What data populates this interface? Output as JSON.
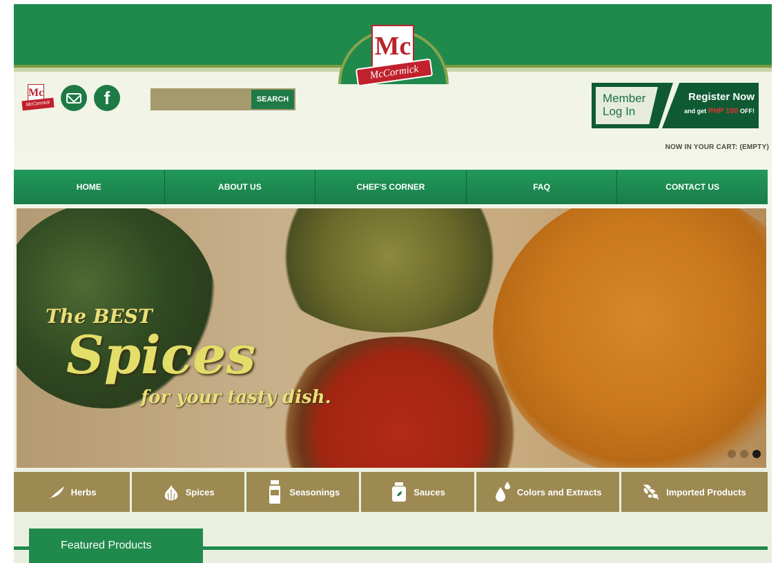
{
  "brand": {
    "logo_monogram": "Mc",
    "logo_ribbon": "McCormick"
  },
  "header": {
    "social": {
      "mini_logo_monogram": "Mc",
      "mini_logo_ribbon": "McCormick",
      "facebook_glyph": "f"
    },
    "search": {
      "placeholder": "",
      "button_label": "SEARCH"
    },
    "member_login": {
      "line1": "Member",
      "line2": "Log In"
    },
    "register": {
      "title": "Register Now",
      "promo_prefix": "and get",
      "promo_amount": "PHP 100",
      "promo_suffix": "OFF!"
    },
    "cart_status": "NOW IN YOUR CART: (EMPTY)"
  },
  "nav": {
    "items": [
      {
        "label": "HOME"
      },
      {
        "label": "ABOUT US"
      },
      {
        "label": "CHEF'S CORNER"
      },
      {
        "label": "FAQ"
      },
      {
        "label": "CONTACT US"
      }
    ]
  },
  "banner": {
    "line1": "The BEST",
    "line2": "Spices",
    "line3": "for your tasty dish.",
    "slide_count": 3,
    "active_slide": 3
  },
  "categories": [
    {
      "label": "Herbs",
      "icon": "leaf-icon"
    },
    {
      "label": "Spices",
      "icon": "garlic-icon"
    },
    {
      "label": "Seasonings",
      "icon": "shaker-icon"
    },
    {
      "label": "Sauces",
      "icon": "jar-icon"
    },
    {
      "label": "Colors and Extracts",
      "icon": "drops-icon"
    },
    {
      "label": "Imported Products",
      "icon": "olive-branch-icon"
    }
  ],
  "featured": {
    "title": "Featured Products"
  },
  "colors": {
    "brand_green": "#1f8a4c",
    "dark_green": "#0f5a33",
    "category_tan": "#9d8a52",
    "brand_red": "#c0212c",
    "promo_red": "#e5312e"
  }
}
